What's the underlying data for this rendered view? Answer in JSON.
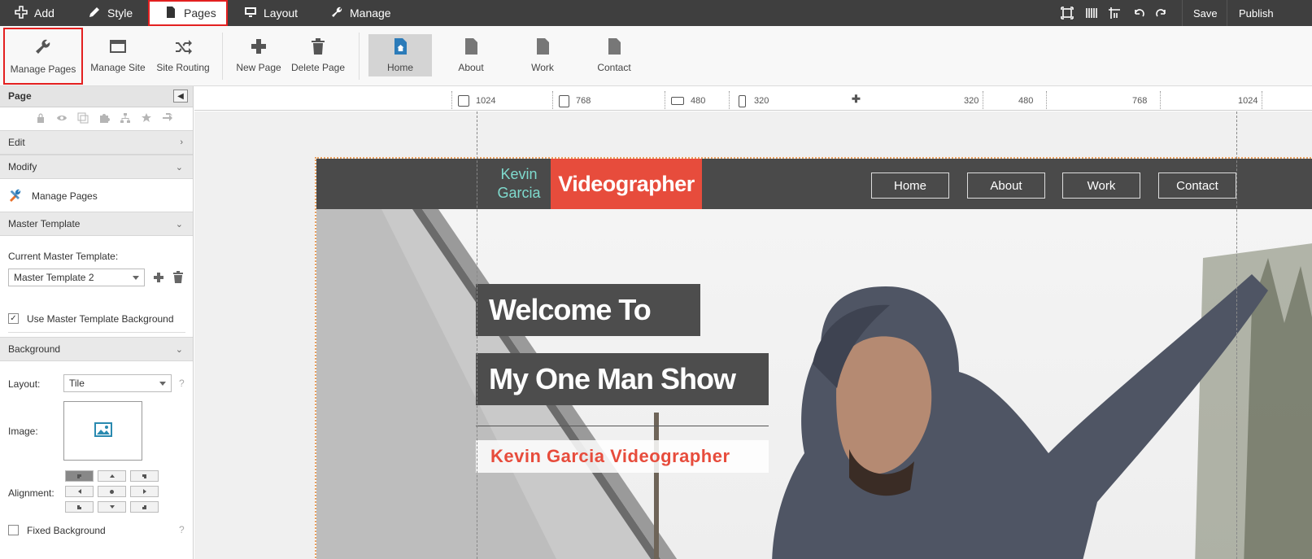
{
  "topbar": {
    "tabs": [
      {
        "label": "Add",
        "icon": "plus-icon"
      },
      {
        "label": "Style",
        "icon": "brush-icon"
      },
      {
        "label": "Pages",
        "icon": "page-icon"
      },
      {
        "label": "Layout",
        "icon": "monitor-icon"
      },
      {
        "label": "Manage",
        "icon": "wrench-icon"
      }
    ],
    "active_tab": "Pages",
    "save_label": "Save",
    "publish_label": "Publish"
  },
  "ribbon": {
    "tools": [
      {
        "label": "Manage Pages",
        "icon": "wrench-icon"
      },
      {
        "label": "Manage Site",
        "icon": "window-icon"
      },
      {
        "label": "Site Routing",
        "icon": "shuffle-icon"
      },
      {
        "label": "New Page",
        "icon": "plus-icon"
      },
      {
        "label": "Delete Page",
        "icon": "trash-icon"
      }
    ],
    "pages": [
      {
        "label": "Home",
        "active": true
      },
      {
        "label": "About",
        "active": false
      },
      {
        "label": "Work",
        "active": false
      },
      {
        "label": "Contact",
        "active": false
      }
    ]
  },
  "sidebar": {
    "panel_title": "Page",
    "sections": {
      "edit": "Edit",
      "modify": "Modify",
      "manage_pages": "Manage Pages",
      "master_template": "Master Template",
      "current_master_label": "Current Master Template:",
      "current_master_value": "Master Template 2",
      "use_master_bg": "Use Master Template Background",
      "use_master_bg_checked": true,
      "background": "Background",
      "layout_label": "Layout:",
      "layout_value": "Tile",
      "image_label": "Image:",
      "alignment_label": "Alignment:",
      "fixed_bg": "Fixed Background",
      "fixed_bg_checked": false
    }
  },
  "ruler": {
    "left_marks": [
      "1024",
      "768",
      "480",
      "320"
    ],
    "right_marks": [
      "320",
      "480",
      "768",
      "1024"
    ]
  },
  "site": {
    "logo_name": "Kevin Garcia",
    "logo_title": "Videographer",
    "nav": [
      "Home",
      "About",
      "Work",
      "Contact"
    ],
    "hero_line1": "Welcome To",
    "hero_line2": "My One Man Show",
    "hero_subtitle": "Kevin Garcia Videographer"
  },
  "colors": {
    "accent_red": "#e74c3c",
    "logo_teal": "#7fdbce",
    "header_dark": "#4a4a4a",
    "topbar": "#3f3f3f",
    "highlight_border": "#e32020"
  }
}
